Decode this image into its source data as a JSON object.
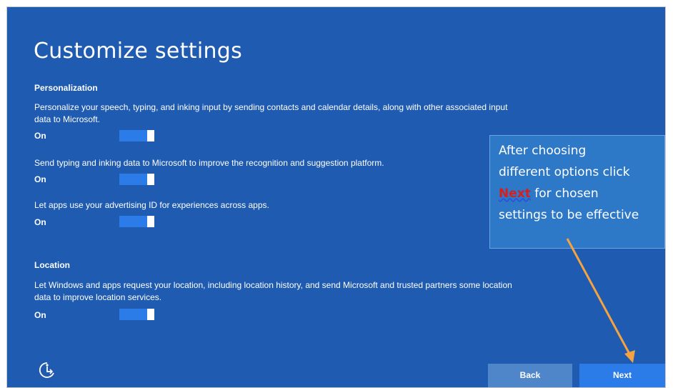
{
  "page": {
    "title": "Customize settings"
  },
  "personalization": {
    "heading": "Personalization",
    "items": [
      {
        "description": "Personalize your speech, typing, and inking input by sending contacts and calendar details, along with other associated input data to Microsoft.",
        "state_label": "On",
        "enabled": true
      },
      {
        "description": "Send typing and inking data to Microsoft to improve the recognition and suggestion platform.",
        "state_label": "On",
        "enabled": true
      },
      {
        "description": "Let apps use your advertising ID for experiences across apps.",
        "state_label": "On",
        "enabled": true
      }
    ]
  },
  "location": {
    "heading": "Location",
    "items": [
      {
        "description": "Let Windows and apps request your location, including location history, and send Microsoft and trusted partners some location data to improve location services.",
        "state_label": "On",
        "enabled": true
      }
    ]
  },
  "footer": {
    "ease_of_access_icon": "ease-of-access-icon",
    "back_label": "Back",
    "next_label": "Next"
  },
  "callout": {
    "line1": "After choosing",
    "line2": "different options click",
    "highlight": "Next",
    "line3_rest": " for chosen",
    "line4": "settings to be effective"
  },
  "colors": {
    "background": "#1f5bb0",
    "toggle_on": "#2b7ce9",
    "callout_bg": "#2e78c8",
    "arrow": "#f4a340",
    "highlight_text": "#d81e1e"
  }
}
